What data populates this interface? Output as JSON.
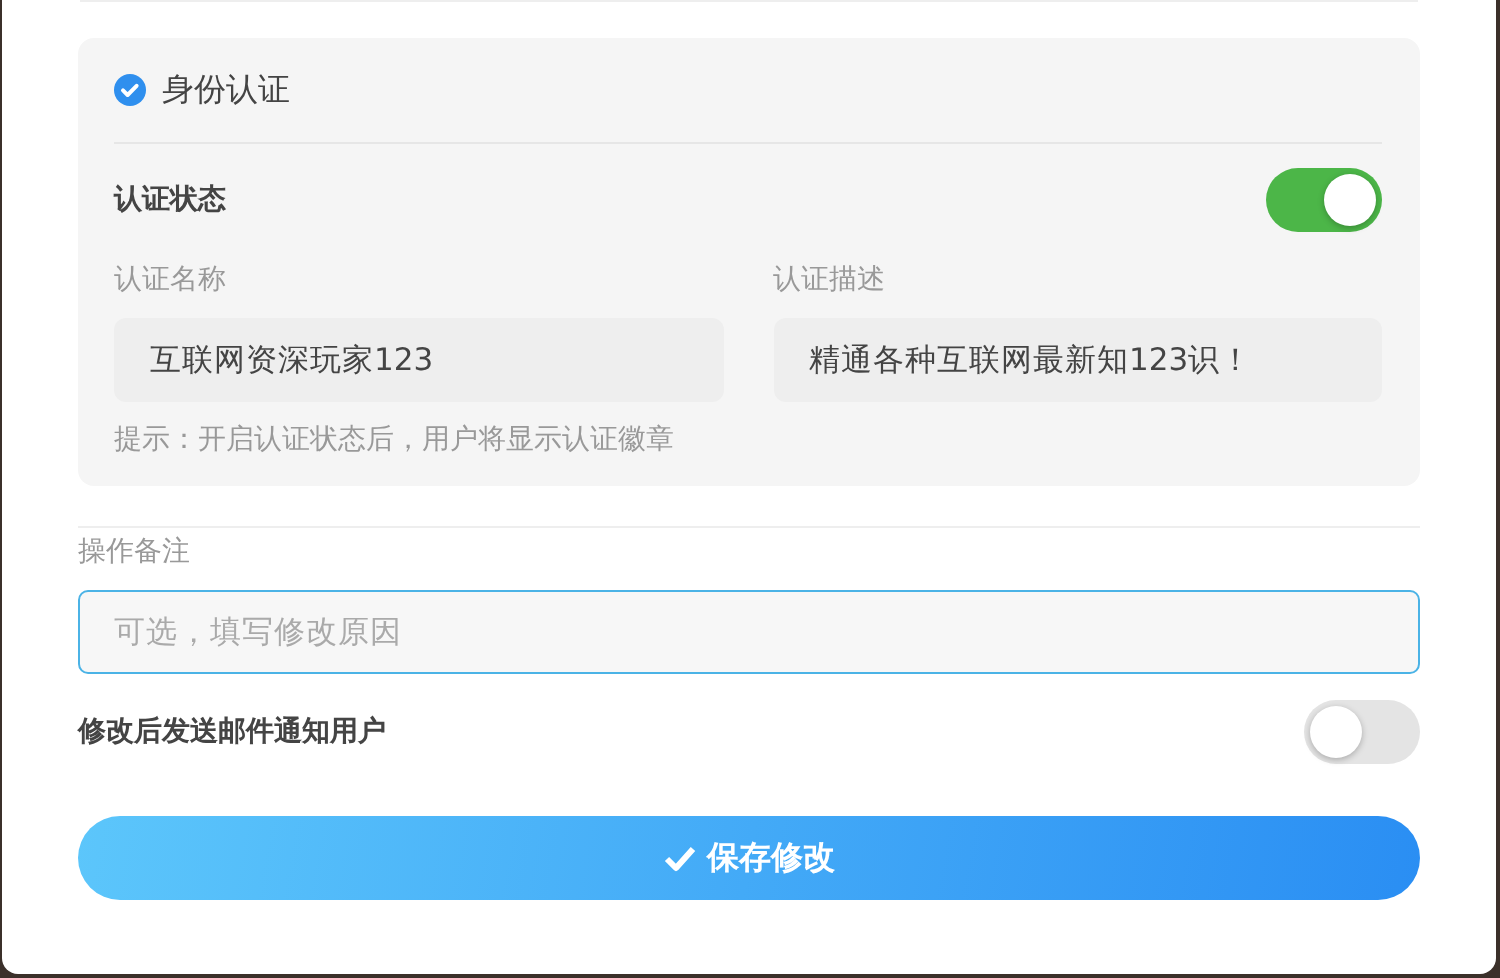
{
  "identity_section": {
    "title": "身份认证",
    "status": {
      "label": "认证状态",
      "on": true
    },
    "fields": [
      {
        "label": "认证名称",
        "value": "互联网资深玩家123"
      },
      {
        "label": "认证描述",
        "value": "精通各种互联网最新知123识！"
      }
    ],
    "hint": "提示：开启认证状态后，用户将显示认证徽章"
  },
  "remark": {
    "label": "操作备注",
    "placeholder": "可选，填写修改原因",
    "focused": true
  },
  "notify": {
    "label": "修改后发送邮件通知用户",
    "on": false
  },
  "save_button": {
    "label": "保存修改"
  }
}
